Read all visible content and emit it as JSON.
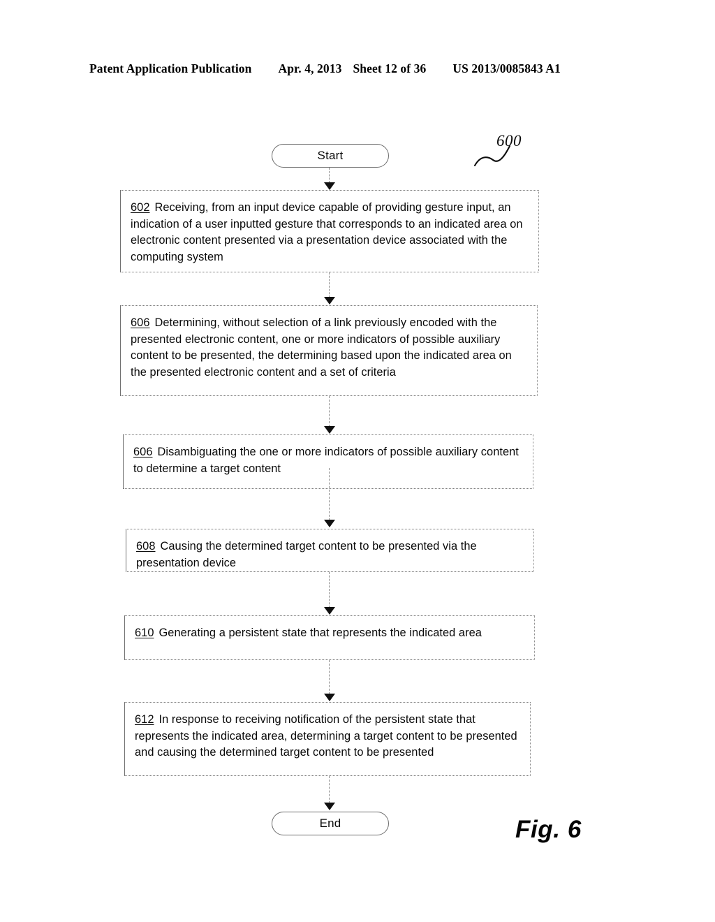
{
  "header": {
    "publication": "Patent Application Publication",
    "date": "Apr. 4, 2013",
    "sheet": "Sheet 12 of 36",
    "publication_number": "US 2013/0085843 A1"
  },
  "figure": {
    "caption": "Fig. 6",
    "reference_numeral": "600"
  },
  "flowchart": {
    "start_label": "Start",
    "end_label": "End",
    "steps": [
      {
        "number": "602",
        "text": "Receiving, from an input device capable of providing gesture input, an indication of a user inputted gesture that corresponds to an indicated area on electronic content presented via a presentation device associated with the computing system"
      },
      {
        "number": "606",
        "text": "Determining, without selection of a link previously encoded with the presented electronic content, one or more indicators of possible auxiliary content to be presented, the determining based upon the indicated area on the presented electronic content and a set of criteria"
      },
      {
        "number": "606",
        "text": "Disambiguating the one or more indicators of possible auxiliary content to determine a target content"
      },
      {
        "number": "608",
        "text": "Causing the determined target content to be presented via the presentation device"
      },
      {
        "number": "610",
        "text": "Generating a persistent state that represents the indicated area"
      },
      {
        "number": "612",
        "text": "In response to receiving notification of the persistent state that represents the indicated area, determining a target content to be presented and causing the determined target content to be presented"
      }
    ]
  }
}
